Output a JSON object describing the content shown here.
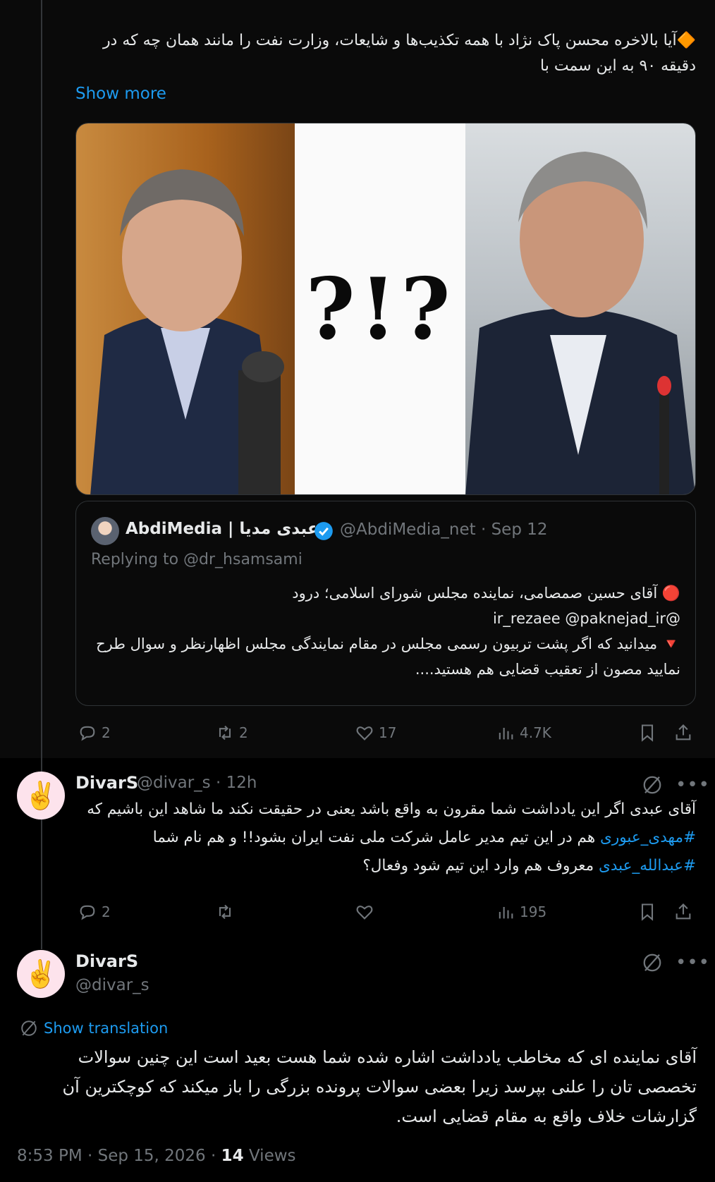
{
  "tweet1": {
    "text": "🔶آیا بالاخره محسن پاک نژاد با همه تکذیب‌ها و شایعات، وزارت نفت را مانند همان چه که در دقیقه ۹۰ به این سمت با",
    "show_more": "Show more",
    "media_punctuation": "?!?",
    "quote": {
      "name": "AbdiMedia | عبدی مدیا",
      "handle_date": "@AbdiMedia_net · Sep 12",
      "replying_to": "Replying to @dr_hsamsami",
      "line1": "🔴 آقای حسین صمصامی، نماینده مجلس شورای اسلامی؛ درود",
      "line2": "@ir_rezaee @paknejad_ir",
      "line3": "🔻 میدانید که اگر پشت تربیون رسمی مجلس در مقام نمایندگی مجلس اظهارنظر و سوال طرح نمایید مصون از تعقیب قضایی هم هستید...."
    },
    "actions": {
      "replies": "2",
      "reposts": "2",
      "likes": "17",
      "views": "4.7K"
    }
  },
  "reply": {
    "avatar": "✌️",
    "name": "DivarS",
    "handle_time": "@divar_s · 12h",
    "text_part1": "آقای عبدی اگر این یادداشت شما مقرون به واقع باشد یعنی در حقیقت نکند ما شاهد این باشیم که ",
    "hashtag1": "#مهدی_عبوری",
    "text_part2": " هم  در این تیم مدیر عامل شرکت ملی نفت ایران بشود!! و هم نام شما ",
    "hashtag2": "#عبدالله_عبدی",
    "text_part3": " معروف هم وارد این تیم شود وفعال؟",
    "actions": {
      "replies": "2",
      "reposts": "",
      "likes": "",
      "views": "195"
    }
  },
  "main": {
    "avatar": "✌️",
    "name": "DivarS",
    "handle": "@divar_s",
    "show_translation": "Show translation",
    "text": "آقای نماینده ای که مخاطب یادداشت اشاره شده شما هست بعید است این چنین سوالات تخصصی تان را علنی بپرسد زیرا بعضی سوالات پرونده بزرگی را باز میکند که کوچکترین آن گزارشات خلاف واقع به مقام قضایی است.",
    "timestamp": "8:53 PM · Sep 15, 2026 · ",
    "views_count": "14",
    "views_label": " Views"
  },
  "colors": {
    "accent": "#1d9bf0",
    "muted": "#71767b",
    "text": "#e7e9ea",
    "background": "#000000"
  },
  "icons": [
    "reply-icon",
    "repost-icon",
    "like-icon",
    "views-icon",
    "bookmark-icon",
    "share-icon",
    "grok-icon",
    "more-icon",
    "verified-icon",
    "translate-icon"
  ]
}
